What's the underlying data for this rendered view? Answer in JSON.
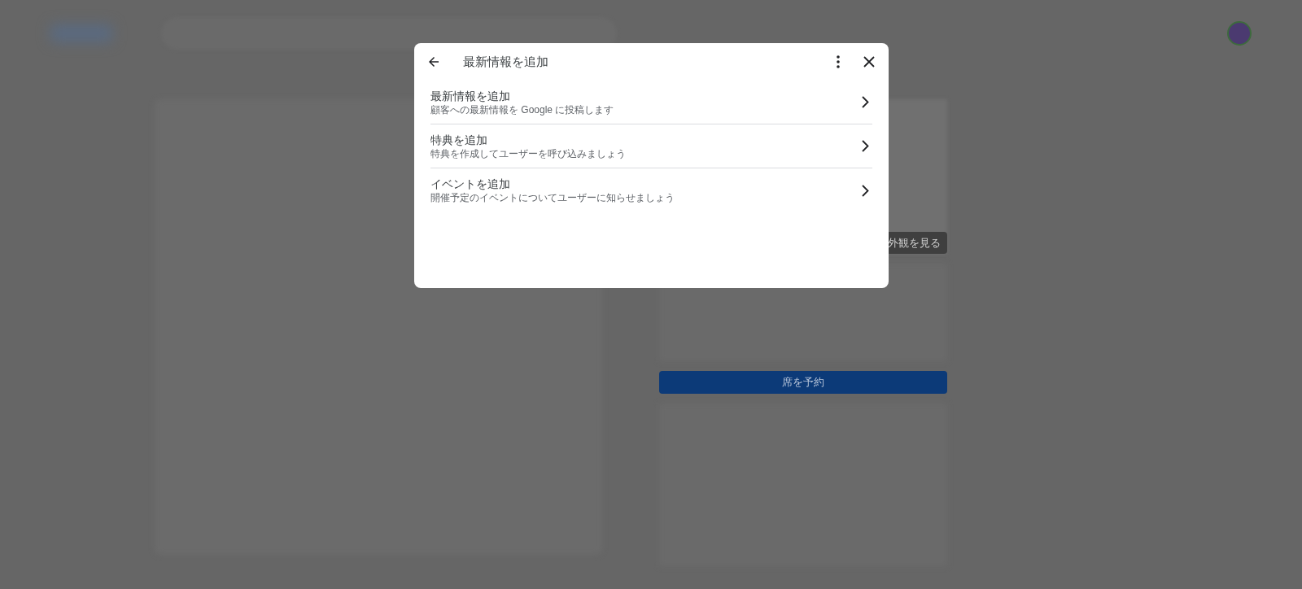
{
  "background": {
    "photo_label": "外観を見る",
    "reserve_button": "席を予約"
  },
  "dialog": {
    "title": "最新情報を追加",
    "items": [
      {
        "title": "最新情報を追加",
        "description": "顧客への最新情報を Google に投稿します"
      },
      {
        "title": "特典を追加",
        "description": "特典を作成してユーザーを呼び込みましょう"
      },
      {
        "title": "イベントを追加",
        "description": "開催予定のイベントについてユーザーに知らせましょう"
      }
    ]
  }
}
